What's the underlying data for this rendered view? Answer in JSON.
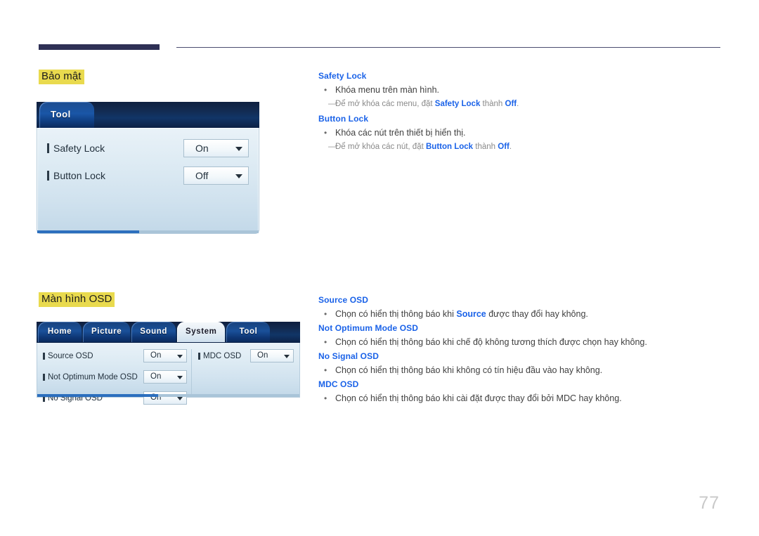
{
  "page": {
    "number": "77"
  },
  "sections": [
    {
      "heading": "Bảo mật",
      "panel": {
        "type": "tool-panel",
        "tabs": [
          {
            "label": "Tool",
            "selected": true
          }
        ],
        "rows": [
          {
            "label": "Safety Lock",
            "value": "On"
          },
          {
            "label": "Button Lock",
            "value": "Off"
          }
        ]
      }
    },
    {
      "heading": "Màn hình OSD",
      "panel": {
        "type": "osd-panel",
        "tabs": [
          {
            "label": "Home",
            "selected": false
          },
          {
            "label": "Picture",
            "selected": false
          },
          {
            "label": "Sound",
            "selected": false
          },
          {
            "label": "System",
            "selected": true
          },
          {
            "label": "Tool",
            "selected": false
          }
        ],
        "rows_left": [
          {
            "label": "Source OSD",
            "value": "On"
          },
          {
            "label": "Not Optimum Mode OSD",
            "value": "On"
          },
          {
            "label": "No Signal OSD",
            "value": "On"
          }
        ],
        "rows_right": [
          {
            "label": "MDC OSD",
            "value": "On"
          }
        ]
      }
    }
  ],
  "text_security": {
    "term1": "Safety Lock",
    "bullet1": "Khóa menu trên màn hình.",
    "note1_pre": "Để mở khóa các menu, đặt ",
    "note1_term": "Safety Lock",
    "note1_mid": " thành ",
    "note1_value": "Off",
    "note1_post": ".",
    "term2": "Button Lock",
    "bullet2": "Khóa các nút trên thiết bị hiển thị.",
    "note2_pre": "Để mở khóa các nút, đặt ",
    "note2_term": "Button Lock",
    "note2_mid": " thành ",
    "note2_value": "Off",
    "note2_post": "."
  },
  "text_osd": {
    "term1": "Source OSD",
    "bullet1_pre": "Chọn có hiển thị thông báo khi ",
    "bullet1_term": "Source",
    "bullet1_post": " được thay đổi hay không.",
    "term2": "Not Optimum Mode OSD",
    "bullet2": "Chọn có hiển thị thông báo khi chế độ không tương thích được chọn hay không.",
    "term3": "No Signal OSD",
    "bullet3": "Chọn có hiển thị thông báo khi không có tín hiệu đầu vào hay không.",
    "term4": "MDC OSD",
    "bullet4": "Chọn có hiển thị thông báo khi cài đặt được thay đổi bởi MDC hay không."
  },
  "colors": {
    "accent_blue": "#1a62e8",
    "highlight_yellow": "#e9da4e",
    "rule_navy": "#2e3055",
    "panel_header_navy": "#0e1f3f",
    "page_number_gray": "#c9c9c9"
  }
}
